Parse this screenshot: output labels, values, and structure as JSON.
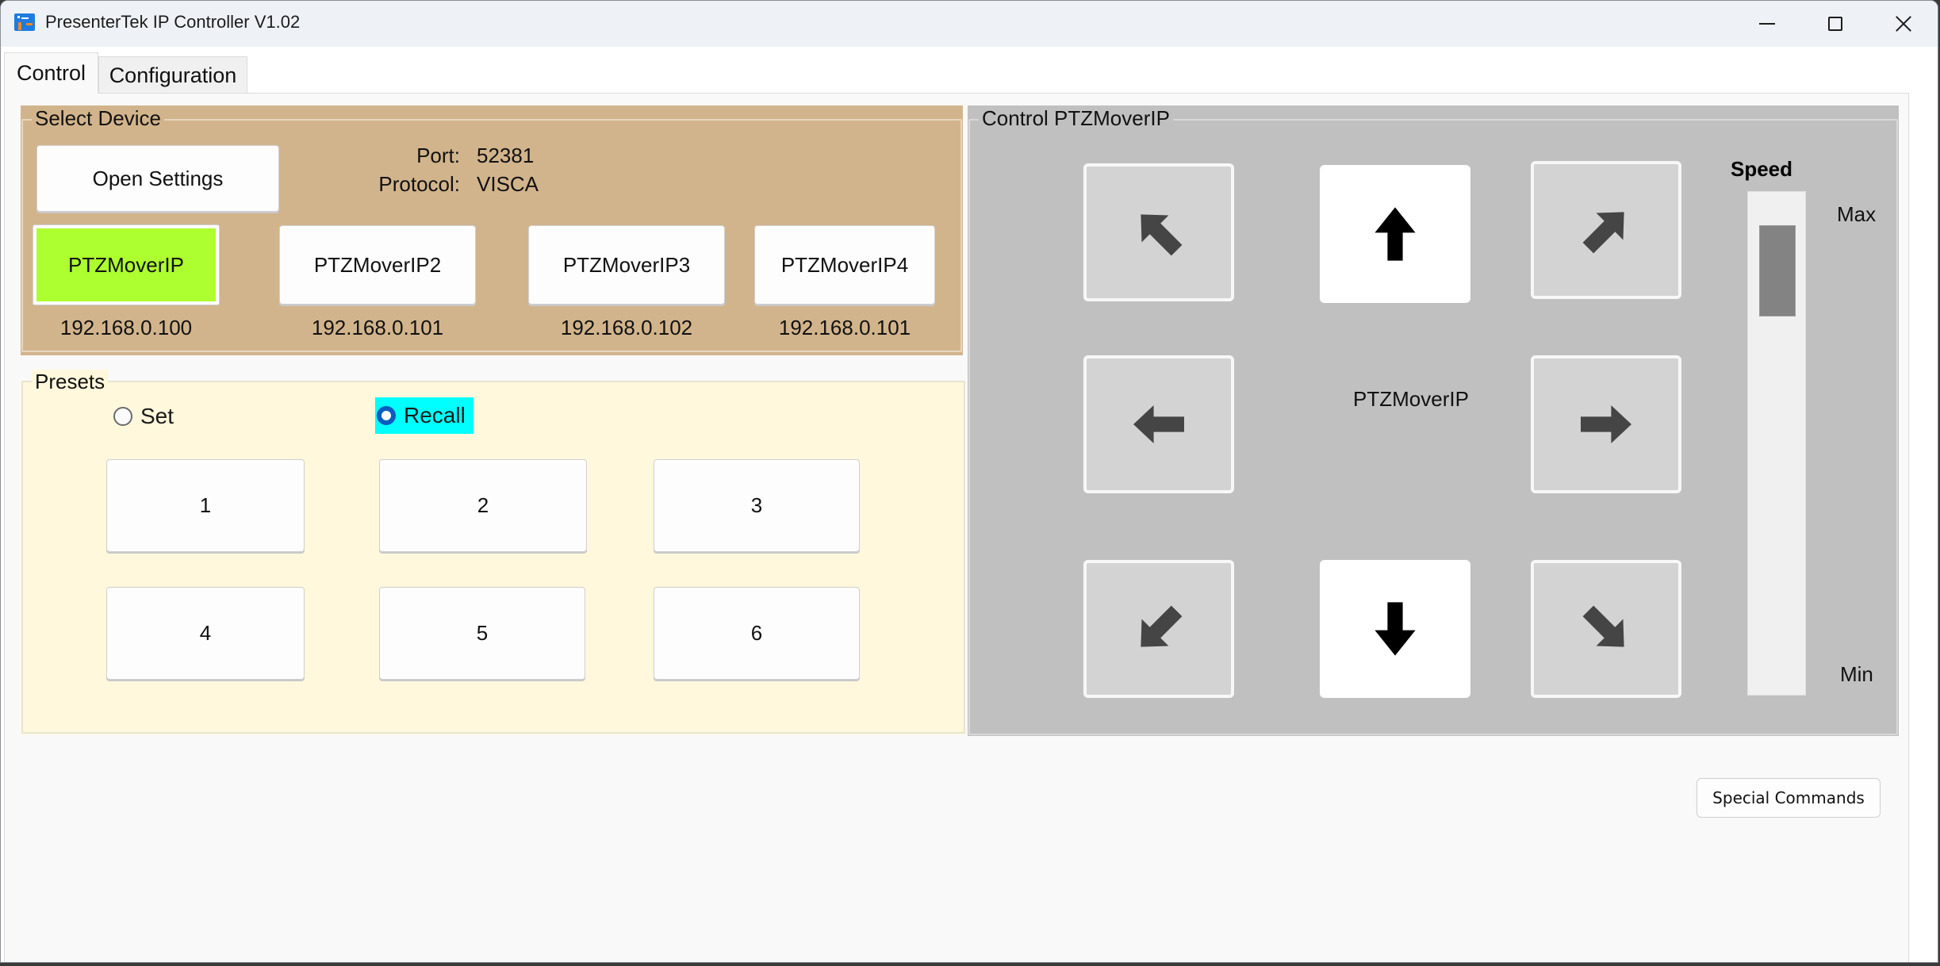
{
  "window": {
    "title": "PresenterTek IP Controller V1.02",
    "app_icon": "presentertek-app-icon",
    "controls": {
      "minimize": "minimize-icon",
      "maximize": "maximize-icon",
      "close": "close-icon"
    }
  },
  "tabs": [
    {
      "label": "Control",
      "active": true
    },
    {
      "label": "Configuration",
      "active": false
    }
  ],
  "select_device": {
    "title": "Select Device",
    "open_settings_label": "Open Settings",
    "port_label": "Port:",
    "port_value": "52381",
    "protocol_label": "Protocol:",
    "protocol_value": "VISCA",
    "selected_color": "#adff2f",
    "devices": [
      {
        "name": "PTZMoverIP",
        "ip": "192.168.0.100",
        "selected": true
      },
      {
        "name": "PTZMoverIP2",
        "ip": "192.168.0.101",
        "selected": false
      },
      {
        "name": "PTZMoverIP3",
        "ip": "192.168.0.102",
        "selected": false
      },
      {
        "name": "PTZMoverIP4",
        "ip": "192.168.0.101",
        "selected": false
      }
    ]
  },
  "presets": {
    "title": "Presets",
    "mode_options": [
      {
        "label": "Set",
        "checked": false
      },
      {
        "label": "Recall",
        "checked": true
      }
    ],
    "highlight_color": "#00ffff",
    "buttons": [
      "1",
      "2",
      "3",
      "4",
      "5",
      "6"
    ]
  },
  "control": {
    "title": "Control PTZMoverIP",
    "device_label": "PTZMoverIP",
    "directions": [
      {
        "name": "up-left",
        "icon": "arrow-up-left-icon"
      },
      {
        "name": "up",
        "icon": "arrow-up-icon"
      },
      {
        "name": "up-right",
        "icon": "arrow-up-right-icon"
      },
      {
        "name": "left",
        "icon": "arrow-left-icon"
      },
      {
        "name": "right",
        "icon": "arrow-right-icon"
      },
      {
        "name": "down-left",
        "icon": "arrow-down-left-icon"
      },
      {
        "name": "down",
        "icon": "arrow-down-icon"
      },
      {
        "name": "down-right",
        "icon": "arrow-down-right-icon"
      }
    ],
    "speed": {
      "label": "Speed",
      "max_label": "Max",
      "min_label": "Min",
      "value_fraction": 0.95
    }
  },
  "special_commands_label": "Special Commands"
}
